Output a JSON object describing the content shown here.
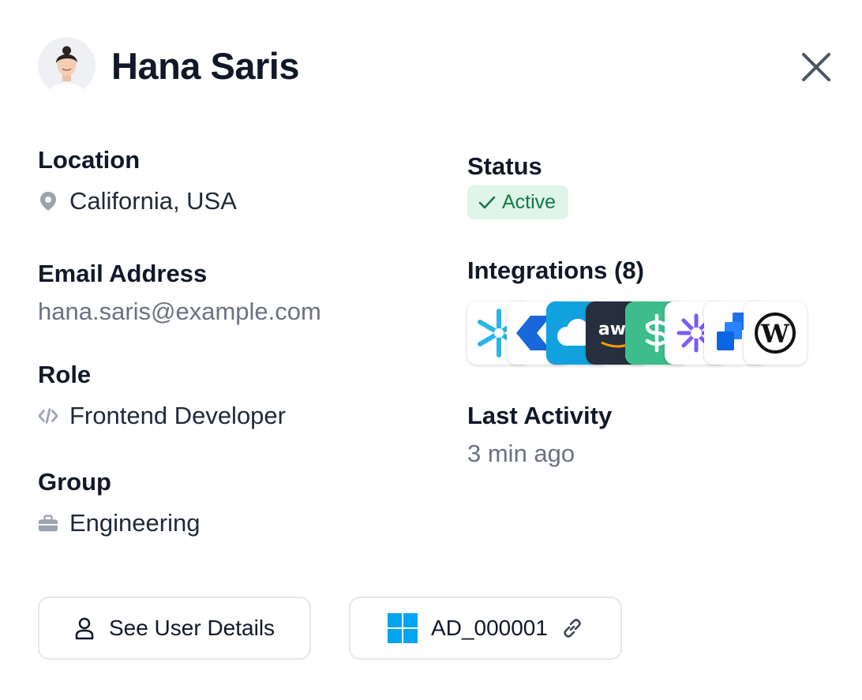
{
  "user": {
    "name": "Hana Saris"
  },
  "location": {
    "label": "Location",
    "value": "California, USA"
  },
  "email": {
    "label": "Email Address",
    "value": "hana.saris@example.com"
  },
  "role": {
    "label": "Role",
    "value": "Frontend Developer"
  },
  "group": {
    "label": "Group",
    "value": "Engineering"
  },
  "status": {
    "label": "Status",
    "value": "Active",
    "color": "#117a45",
    "bg": "#dff5ea"
  },
  "integrations": {
    "label": "Integrations (8)",
    "icons": [
      "snowflake-icon",
      "atlassian-icon",
      "salesforce-icon",
      "aws-icon",
      "sentry-icon",
      "asterisk-icon",
      "jira-icon",
      "wordpress-icon"
    ]
  },
  "last_activity": {
    "label": "Last Activity",
    "value": "3 min ago"
  },
  "buttons": {
    "details_label": "See User Details",
    "ad_label": "AD_000001"
  }
}
